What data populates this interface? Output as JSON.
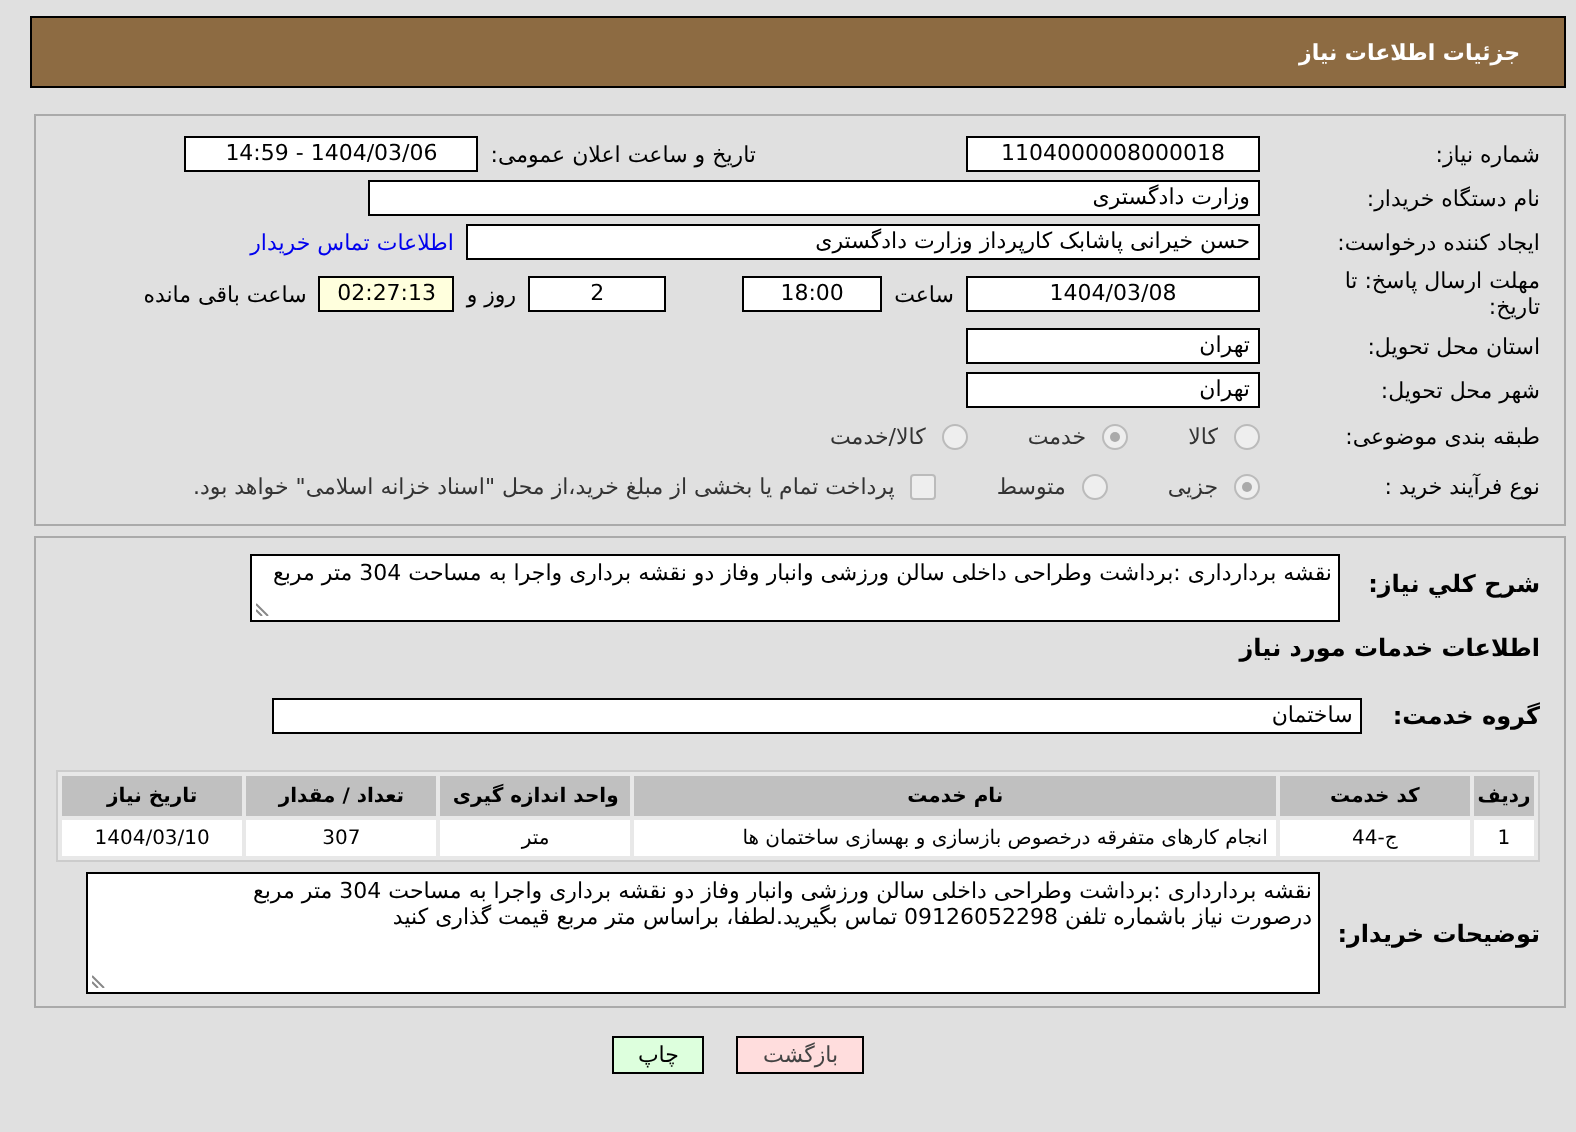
{
  "header": {
    "title": "جزئیات اطلاعات نیاز"
  },
  "need_number": {
    "label": "شماره نیاز:",
    "value": "1104000008000018"
  },
  "announce": {
    "label": "تاریخ و ساعت اعلان عمومی:",
    "value": "1404/03/06 - 14:59"
  },
  "buyer_org": {
    "label": "نام دستگاه خریدار:",
    "value": "وزارت دادگستری"
  },
  "creator": {
    "label": "ایجاد کننده درخواست:",
    "value": "حسن خیرانی پاشابک کارپرداز وزارت دادگستری",
    "link": "اطلاعات تماس خریدار"
  },
  "deadline": {
    "label": "مهلت ارسال پاسخ: تا تاریخ:",
    "date": "1404/03/08",
    "time_label": "ساعت",
    "time": "18:00",
    "days": "2",
    "days_label": "روز و",
    "remaining": "02:27:13",
    "remaining_label": "ساعت باقی مانده"
  },
  "province": {
    "label": "استان محل تحویل:",
    "value": "تهران"
  },
  "city": {
    "label": "شهر محل تحویل:",
    "value": "تهران"
  },
  "category": {
    "label": "طبقه بندی موضوعی:",
    "options": [
      {
        "label": "کالا",
        "selected": false
      },
      {
        "label": "خدمت",
        "selected": true
      },
      {
        "label": "کالا/خدمت",
        "selected": false
      }
    ]
  },
  "process": {
    "label": "نوع فرآیند خرید :",
    "options": [
      {
        "label": "جزیی",
        "selected": true
      },
      {
        "label": "متوسط",
        "selected": false
      }
    ],
    "payment": {
      "checked": false,
      "label": "پرداخت تمام یا بخشی از مبلغ خرید،از محل \"اسناد خزانه اسلامی\" خواهد بود."
    }
  },
  "description": {
    "label": "شرح کلي نياز:",
    "value": "نقشه برداردارى :برداشت وطراحی داخلی سالن ورزشی وانبار وفاز دو نقشه برداری واجرا به مساحت 304 متر مربع"
  },
  "services_title": "اطلاعات خدمات مورد نياز",
  "service_group": {
    "label": "گروه خدمت:",
    "value": "ساختمان"
  },
  "table": {
    "columns": [
      "ردیف",
      "کد خدمت",
      "نام خدمت",
      "واحد اندازه گیری",
      "تعداد / مقدار",
      "تاریخ نیاز"
    ],
    "rows": [
      [
        "1",
        "ج-44",
        "انجام کارهای متفرقه درخصوص بازسازی و بهسازی ساختمان ها",
        "متر",
        "307",
        "1404/03/10"
      ]
    ]
  },
  "buyer_notes": {
    "label": "توضیحات خریدار:",
    "lines": [
      "نقشه برداردارى :برداشت وطراحی داخلی سالن ورزشی وانبار وفاز دو نقشه برداری واجرا به مساحت 304 متر مربع",
      "درصورت نیاز باشماره تلفن 09126052298 تماس بگیرید.لطفا، براساس متر مربع قیمت گذاری کنید"
    ]
  },
  "buttons": [
    {
      "label": "بازگشت",
      "kind": "back"
    },
    {
      "label": "چاپ",
      "kind": "print"
    }
  ]
}
